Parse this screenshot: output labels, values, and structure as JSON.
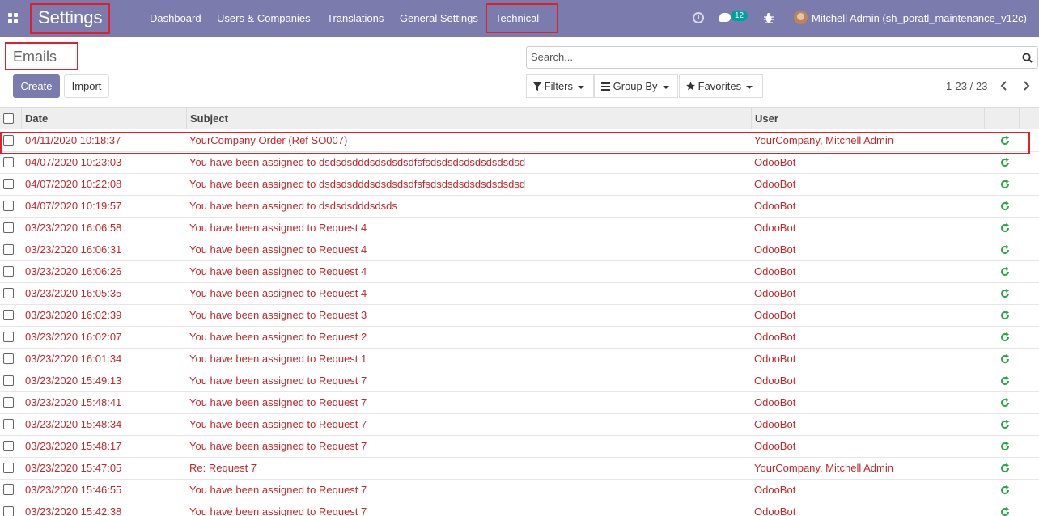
{
  "navbar": {
    "app_title": "Settings",
    "menu": [
      "Dashboard",
      "Users & Companies",
      "Translations",
      "General Settings",
      "Technical"
    ],
    "message_badge": "12",
    "user": "Mitchell Admin (sh_poratl_maintenance_v12c)",
    "icons": [
      "apps-grid-icon",
      "clock-icon",
      "chat-icon",
      "bug-icon",
      "avatar"
    ]
  },
  "control": {
    "breadcrumb": "Emails",
    "create_label": "Create",
    "import_label": "Import",
    "search_placeholder": "Search...",
    "filters_label": "Filters",
    "groupby_label": "Group By",
    "favorites_label": "Favorites",
    "pager": "1-23 / 23"
  },
  "table": {
    "columns": [
      "Date",
      "Subject",
      "User"
    ],
    "rows": [
      {
        "date": "04/11/2020 10:18:37",
        "subject": "YourCompany Order (Ref SO007)",
        "user": "YourCompany, Mitchell Admin"
      },
      {
        "date": "04/07/2020 10:23:03",
        "subject": "You have been assigned to dsdsdsdddsdsdsdsdfsfsdsdsdsdsdsdsdsdsd",
        "user": "OdooBot"
      },
      {
        "date": "04/07/2020 10:22:08",
        "subject": "You have been assigned to dsdsdsdddsdsdsdsdfsfsdsdsdsdsdsdsdsdsd",
        "user": "OdooBot"
      },
      {
        "date": "04/07/2020 10:19:57",
        "subject": "You have been assigned to dsdsdsdddsdsds",
        "user": "OdooBot"
      },
      {
        "date": "03/23/2020 16:06:58",
        "subject": "You have been assigned to Request 4",
        "user": "OdooBot"
      },
      {
        "date": "03/23/2020 16:06:31",
        "subject": "You have been assigned to Request 4",
        "user": "OdooBot"
      },
      {
        "date": "03/23/2020 16:06:26",
        "subject": "You have been assigned to Request 4",
        "user": "OdooBot"
      },
      {
        "date": "03/23/2020 16:05:35",
        "subject": "You have been assigned to Request 4",
        "user": "OdooBot"
      },
      {
        "date": "03/23/2020 16:02:39",
        "subject": "You have been assigned to Request 3",
        "user": "OdooBot"
      },
      {
        "date": "03/23/2020 16:02:07",
        "subject": "You have been assigned to Request 2",
        "user": "OdooBot"
      },
      {
        "date": "03/23/2020 16:01:34",
        "subject": "You have been assigned to Request 1",
        "user": "OdooBot"
      },
      {
        "date": "03/23/2020 15:49:13",
        "subject": "You have been assigned to Request 7",
        "user": "OdooBot"
      },
      {
        "date": "03/23/2020 15:48:41",
        "subject": "You have been assigned to Request 7",
        "user": "OdooBot"
      },
      {
        "date": "03/23/2020 15:48:34",
        "subject": "You have been assigned to Request 7",
        "user": "OdooBot"
      },
      {
        "date": "03/23/2020 15:48:17",
        "subject": "You have been assigned to Request 7",
        "user": "OdooBot"
      },
      {
        "date": "03/23/2020 15:47:05",
        "subject": "Re: Request 7",
        "user": "YourCompany, Mitchell Admin"
      },
      {
        "date": "03/23/2020 15:46:55",
        "subject": "You have been assigned to Request 7",
        "user": "OdooBot"
      },
      {
        "date": "03/23/2020 15:42:38",
        "subject": "You have been assigned to Request 7",
        "user": "OdooBot"
      }
    ]
  },
  "colors": {
    "navbar": "#7c7bad",
    "row_text": "#c0282d",
    "retry_icon": "#28a745",
    "highlight_box": "#e0202a"
  }
}
